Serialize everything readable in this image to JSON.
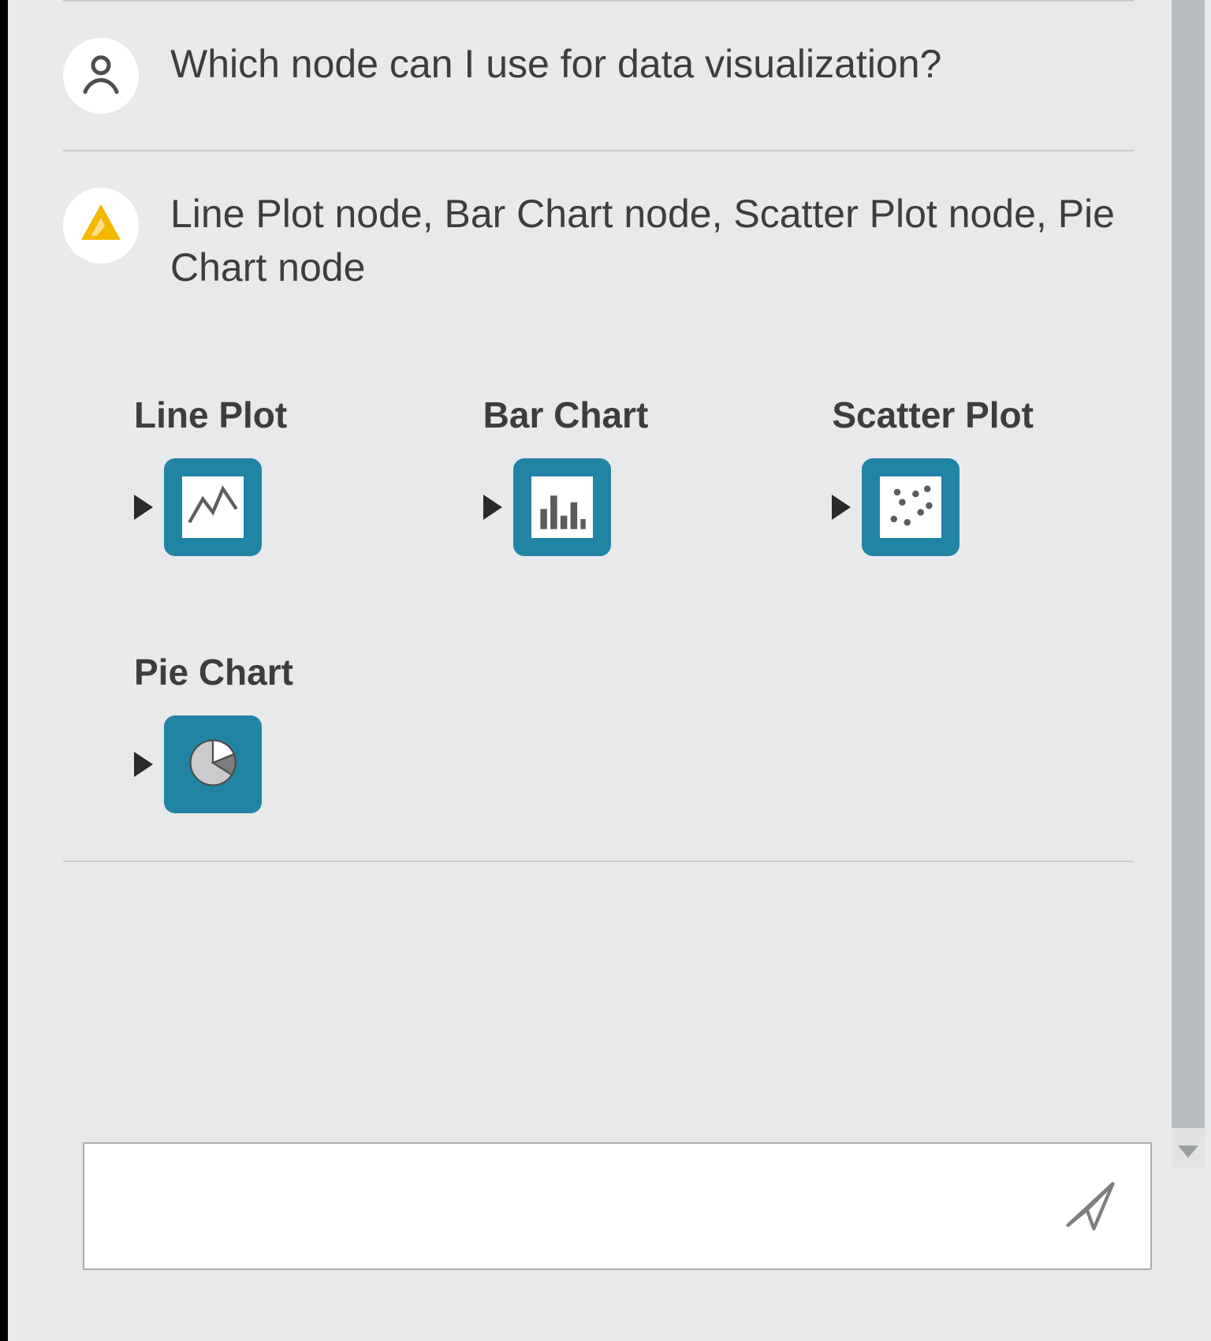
{
  "colors": {
    "accent": "#2184a4",
    "assistant_icon": "#f3b700",
    "text": "#3c3d3d"
  },
  "conversation": {
    "user": {
      "text": "Which node can I use for data visualization?"
    },
    "assistant": {
      "text": "Line Plot node, Bar Chart node, Scatter Plot node, Pie Chart node"
    }
  },
  "nodes": [
    {
      "label": "Line Plot",
      "icon": "line-plot-icon"
    },
    {
      "label": "Bar Chart",
      "icon": "bar-chart-icon"
    },
    {
      "label": "Scatter Plot",
      "icon": "scatter-plot-icon"
    },
    {
      "label": "Pie Chart",
      "icon": "pie-chart-icon"
    }
  ],
  "composer": {
    "value": "",
    "placeholder": ""
  }
}
